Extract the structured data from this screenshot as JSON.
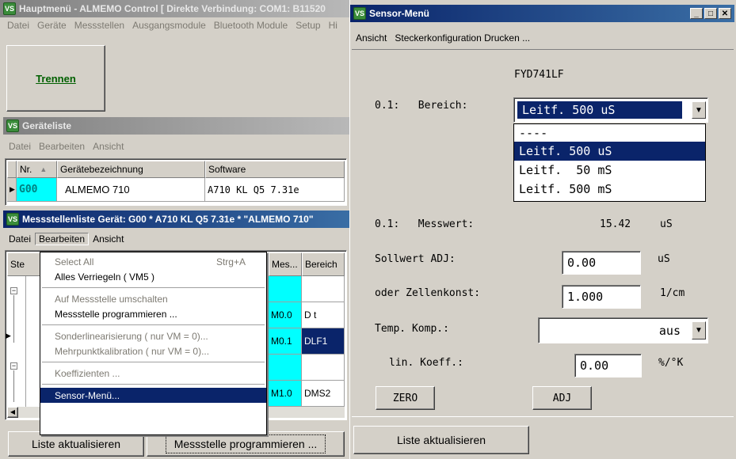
{
  "main_window": {
    "title": "Hauptmenü - ALMEMO Control [ Direkte Verbindung: COM1: B11520",
    "menu": [
      "Datei",
      "Geräte",
      "Messstellen",
      "Ausgangsmodule",
      "Bluetooth Module",
      "Setup",
      "Hi"
    ],
    "disconnect_button": "Trennen"
  },
  "device_list": {
    "title": "Geräteliste",
    "menu": [
      "Datei",
      "Bearbeiten",
      "Ansicht"
    ],
    "columns": [
      "Nr.",
      "Gerätebezeichnung",
      "Software"
    ],
    "rows": [
      {
        "nr": "G00",
        "name": "ALMEMO 710",
        "software": "A710 KL Q5 7.31e"
      }
    ]
  },
  "channel_list": {
    "title": "Messstellenliste Gerät: G00 * A710 KL Q5 7.31e * \"ALMEMO 710\"",
    "menu": [
      "Datei",
      "Bearbeiten",
      "Ansicht"
    ],
    "columns": [
      "Ste",
      "Mes...",
      "Bereich"
    ],
    "rows": [
      {
        "mes": "",
        "bereich": ""
      },
      {
        "mes": "M0.0",
        "bereich": "D t"
      },
      {
        "mes": "M0.1",
        "bereich": "DLF1"
      },
      {
        "mes": "",
        "bereich": ""
      },
      {
        "mes": "M1.0",
        "bereich": "DMS2"
      }
    ],
    "refresh_button": "Liste aktualisieren",
    "program_button": "Messstelle programmieren ..."
  },
  "edit_menu": {
    "items": [
      {
        "label": "Select All",
        "shortcut": "Strg+A",
        "enabled": false
      },
      {
        "label": "Alles Verriegeln ( VM5 )",
        "enabled": true
      },
      {
        "sep": true
      },
      {
        "label": "Auf Messstelle umschalten",
        "enabled": false
      },
      {
        "label": "Messstelle programmieren ...",
        "enabled": true
      },
      {
        "sep": true
      },
      {
        "label": "Sonderlinearisierung ( nur VM = 0)...",
        "enabled": false
      },
      {
        "label": "Mehrpunktkalibration ( nur VM = 0)...",
        "enabled": false
      },
      {
        "sep": true
      },
      {
        "label": "Koeffizienten ...",
        "enabled": false
      },
      {
        "sep": true
      },
      {
        "label": "Sensor-Menü...",
        "enabled": true,
        "highlighted": true
      }
    ]
  },
  "sensor_window": {
    "title": "Sensor-Menü",
    "menu": [
      "Ansicht",
      "Steckerkonfiguration Drucken ..."
    ],
    "sensor_name": "FYD741LF",
    "range_label": "0.1:   Bereich:",
    "range_value": "Leitf. 500 uS",
    "range_options": [
      "----",
      "Leitf. 500 uS",
      "Leitf.  50 mS",
      "Leitf. 500 mS"
    ],
    "range_selected_index": 1,
    "measured_label": "0.1:   Messwert:",
    "measured_value": "15.42",
    "measured_unit": "uS",
    "setpoint_label": "Sollwert ADJ:",
    "setpoint_value": "0.00",
    "setpoint_unit": "uS",
    "cell_label": "oder Zellenkonst:",
    "cell_value": "1.000",
    "cell_unit": "1/cm",
    "temp_label": "Temp. Komp.:",
    "temp_value": "aus",
    "coeff_label": "lin. Koeff.:",
    "coeff_value": "0.00",
    "coeff_unit": "%/°K",
    "zero_button": "ZERO",
    "adj_button": "ADJ",
    "refresh_button": "Liste aktualisieren"
  },
  "colors": {
    "selection": "#0a246a",
    "cyan_cell": "#00ffff",
    "title_active": "#0a246a"
  }
}
